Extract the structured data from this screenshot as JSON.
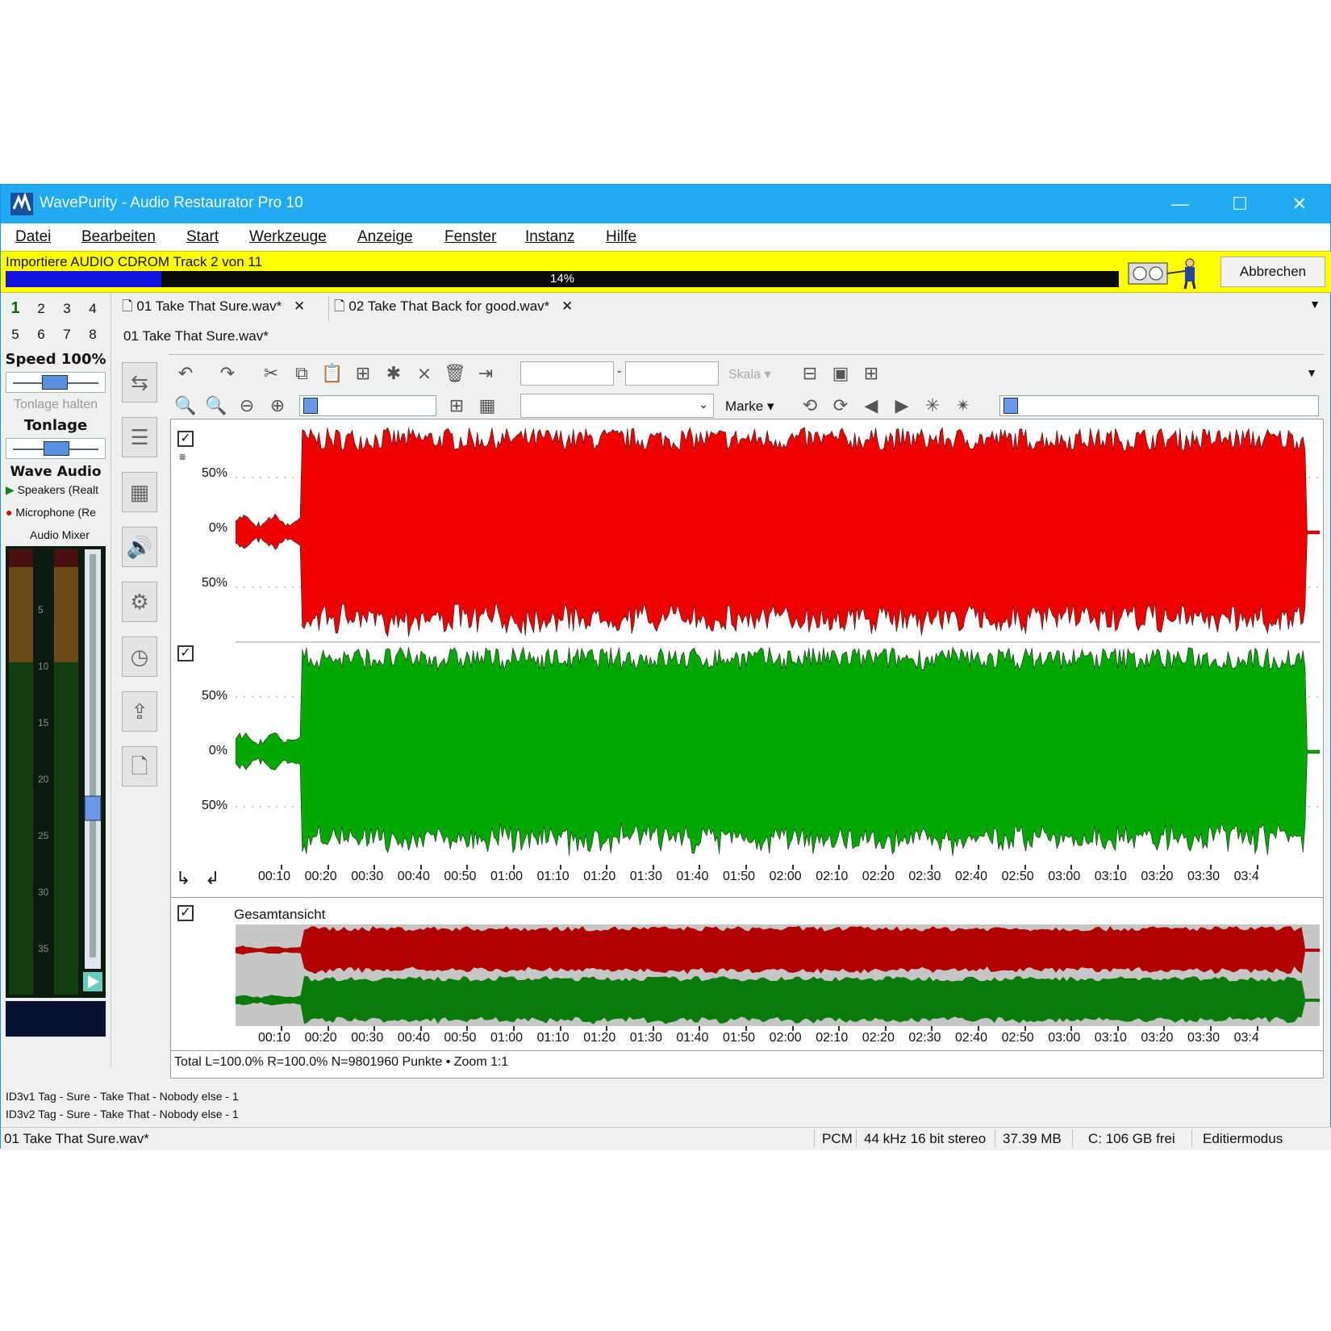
{
  "window": {
    "title": "WavePurity - Audio Restaurator Pro 10",
    "minimize": "—",
    "maximize": "☐",
    "close": "✕"
  },
  "menu": [
    "Datei",
    "Bearbeiten",
    "Start",
    "Werkzeuge",
    "Anzeige",
    "Fenster",
    "Instanz",
    "Hilfe"
  ],
  "import": {
    "message": "Importiere AUDIO CDROM Track 2 von 11",
    "progress_label": "14%",
    "progress": 0.14,
    "abort_label": "Abbrechen"
  },
  "instances": [
    "1",
    "2",
    "3",
    "4",
    "5",
    "6",
    "7",
    "8"
  ],
  "left": {
    "speed_label": "Speed 100%",
    "hold_label": "Tonlage halten",
    "pitch_label": "Tonlage",
    "wave_audio_label": "Wave Audio",
    "speakers_label": "Speakers (Realt",
    "microphone_label": "Microphone (Re",
    "mixer_label": "Audio Mixer",
    "meter_scale": [
      "5",
      "10",
      "15",
      "20",
      "25",
      "30",
      "35"
    ]
  },
  "tabs": [
    {
      "label": "01 Take That Sure.wav*"
    },
    {
      "label": "02 Take That Back for good.wav*"
    }
  ],
  "document": {
    "title": "01 Take That Sure.wav*"
  },
  "toolbar": {
    "scale_label": "Skala",
    "marker_label": "Marke"
  },
  "channels": {
    "top_labels": [
      "50%",
      "0%",
      "50%"
    ],
    "bottom_labels": [
      "50%",
      "0%",
      "50%"
    ]
  },
  "timeline": [
    "00:10",
    "00:20",
    "00:30",
    "00:40",
    "00:50",
    "01:00",
    "01:10",
    "01:20",
    "01:30",
    "01:40",
    "01:50",
    "02:00",
    "02:10",
    "02:20",
    "02:30",
    "02:40",
    "02:50",
    "03:00",
    "03:10",
    "03:20",
    "03:30",
    "03:4"
  ],
  "overview": {
    "label": "Gesamtansicht"
  },
  "summary": "Total L=100.0% R=100.0% N=9801960 Punkte • Zoom 1:1",
  "tags": [
    "ID3v1 Tag - Sure - Take That - Nobody else - 1",
    "ID3v2 Tag - Sure - Take That - Nobody else - 1"
  ],
  "status": {
    "file": "01 Take That Sure.wav*",
    "format": "PCM",
    "quality": "44 kHz 16 bit stereo",
    "size": "37.39 MB",
    "disk": "C: 106 GB frei",
    "mode": "Editiermodus"
  },
  "colors": {
    "left_channel": "#ee0000",
    "right_channel": "#00a800",
    "overview_left": "#b00000",
    "overview_right": "#0a7a0a",
    "titlebar": "#22aaf0",
    "import_bar": "#ffff00"
  },
  "icons": [
    "undo-icon",
    "redo-icon",
    "cut-icon",
    "copy-icon",
    "paste-icon",
    "paste-mix-icon",
    "trim-icon",
    "silence-icon",
    "delete-icon",
    "insert-icon",
    "zoom-fit-icon",
    "zoom-selection-icon",
    "zoom-out-icon",
    "zoom-in-icon",
    "play-icon",
    "rewind-icon"
  ]
}
